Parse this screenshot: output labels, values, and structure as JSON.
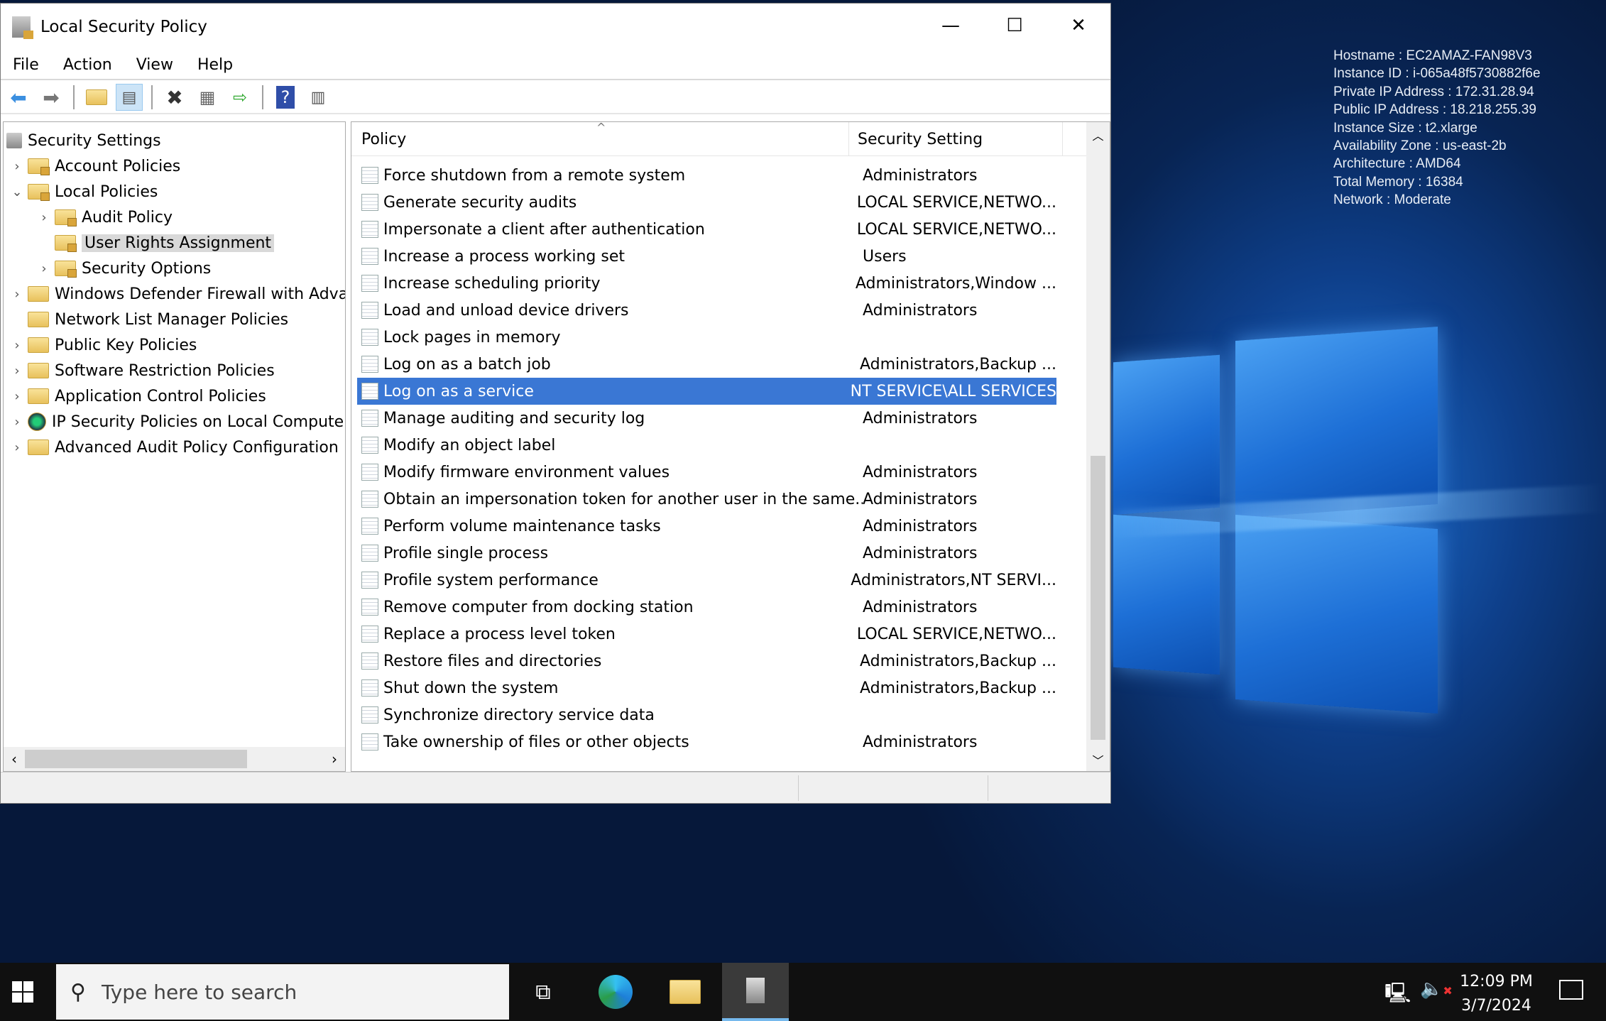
{
  "window": {
    "title": "Local Security Policy",
    "minimize": "—",
    "maximize": "☐",
    "close": "✕"
  },
  "menu": [
    "File",
    "Action",
    "View",
    "Help"
  ],
  "toolbar": [
    "back-icon",
    "forward-icon",
    "up-folder-icon",
    "show-hide-console-tree-icon",
    "delete-icon",
    "properties-icon",
    "export-list-icon",
    "help-icon",
    "show-hide-action-pane-icon"
  ],
  "tree": [
    {
      "label": "Security Settings",
      "level": 0,
      "expander": "",
      "icon": "security-settings"
    },
    {
      "label": "Account Policies",
      "level": 1,
      "expander": "›",
      "icon": "folder-lock"
    },
    {
      "label": "Local Policies",
      "level": 1,
      "expander": "⌄",
      "icon": "folder-lock"
    },
    {
      "label": "Audit Policy",
      "level": 2,
      "expander": "›",
      "icon": "folder-lock"
    },
    {
      "label": "User Rights Assignment",
      "level": 2,
      "expander": "",
      "icon": "folder-lock",
      "selected": true
    },
    {
      "label": "Security Options",
      "level": 2,
      "expander": "›",
      "icon": "folder-lock"
    },
    {
      "label": "Windows Defender Firewall with Adva",
      "level": 1,
      "expander": "›",
      "icon": "folder"
    },
    {
      "label": "Network List Manager Policies",
      "level": 1,
      "expander": "",
      "icon": "folder"
    },
    {
      "label": "Public Key Policies",
      "level": 1,
      "expander": "›",
      "icon": "folder"
    },
    {
      "label": "Software Restriction Policies",
      "level": 1,
      "expander": "›",
      "icon": "folder"
    },
    {
      "label": "Application Control Policies",
      "level": 1,
      "expander": "›",
      "icon": "folder"
    },
    {
      "label": "IP Security Policies on Local Compute",
      "level": 1,
      "expander": "›",
      "icon": "ip-security"
    },
    {
      "label": "Advanced Audit Policy Configuration",
      "level": 1,
      "expander": "›",
      "icon": "folder"
    }
  ],
  "list": {
    "columns": [
      "Policy",
      "Security Setting"
    ],
    "rows": [
      {
        "policy": "Force shutdown from a remote system",
        "setting": "Administrators"
      },
      {
        "policy": "Generate security audits",
        "setting": "LOCAL SERVICE,NETWO..."
      },
      {
        "policy": "Impersonate a client after authentication",
        "setting": "LOCAL SERVICE,NETWO..."
      },
      {
        "policy": "Increase a process working set",
        "setting": "Users"
      },
      {
        "policy": "Increase scheduling priority",
        "setting": "Administrators,Window ..."
      },
      {
        "policy": "Load and unload device drivers",
        "setting": "Administrators"
      },
      {
        "policy": "Lock pages in memory",
        "setting": ""
      },
      {
        "policy": "Log on as a batch job",
        "setting": "Administrators,Backup ..."
      },
      {
        "policy": "Log on as a service",
        "setting": "NT SERVICE\\ALL SERVICES",
        "selected": true
      },
      {
        "policy": "Manage auditing and security log",
        "setting": "Administrators"
      },
      {
        "policy": "Modify an object label",
        "setting": ""
      },
      {
        "policy": "Modify firmware environment values",
        "setting": "Administrators"
      },
      {
        "policy": "Obtain an impersonation token for another user in the same...",
        "setting": "Administrators"
      },
      {
        "policy": "Perform volume maintenance tasks",
        "setting": "Administrators"
      },
      {
        "policy": "Profile single process",
        "setting": "Administrators"
      },
      {
        "policy": "Profile system performance",
        "setting": "Administrators,NT SERVI..."
      },
      {
        "policy": "Remove computer from docking station",
        "setting": "Administrators"
      },
      {
        "policy": "Replace a process level token",
        "setting": "LOCAL SERVICE,NETWO..."
      },
      {
        "policy": "Restore files and directories",
        "setting": "Administrators,Backup ..."
      },
      {
        "policy": "Shut down the system",
        "setting": "Administrators,Backup ..."
      },
      {
        "policy": "Synchronize directory service data",
        "setting": ""
      },
      {
        "policy": "Take ownership of files or other objects",
        "setting": "Administrators"
      }
    ]
  },
  "sysinfo": [
    "Hostname : EC2AMAZ-FAN98V3",
    "Instance ID : i-065a48f5730882f6e",
    "Private IP Address : 172.31.28.94",
    "Public IP Address : 18.218.255.39",
    "Instance Size : t2.xlarge",
    "Availability Zone : us-east-2b",
    "Architecture : AMD64",
    "Total Memory : 16384",
    "Network : Moderate"
  ],
  "taskbar": {
    "search_placeholder": "Type here to search",
    "time": "12:09 PM",
    "date": "3/7/2024",
    "apps": [
      "task-view-icon",
      "edge-icon",
      "file-explorer-icon",
      "local-security-policy-icon"
    ]
  },
  "colors": {
    "selection": "#3a77d4",
    "taskbar": "#101010"
  }
}
